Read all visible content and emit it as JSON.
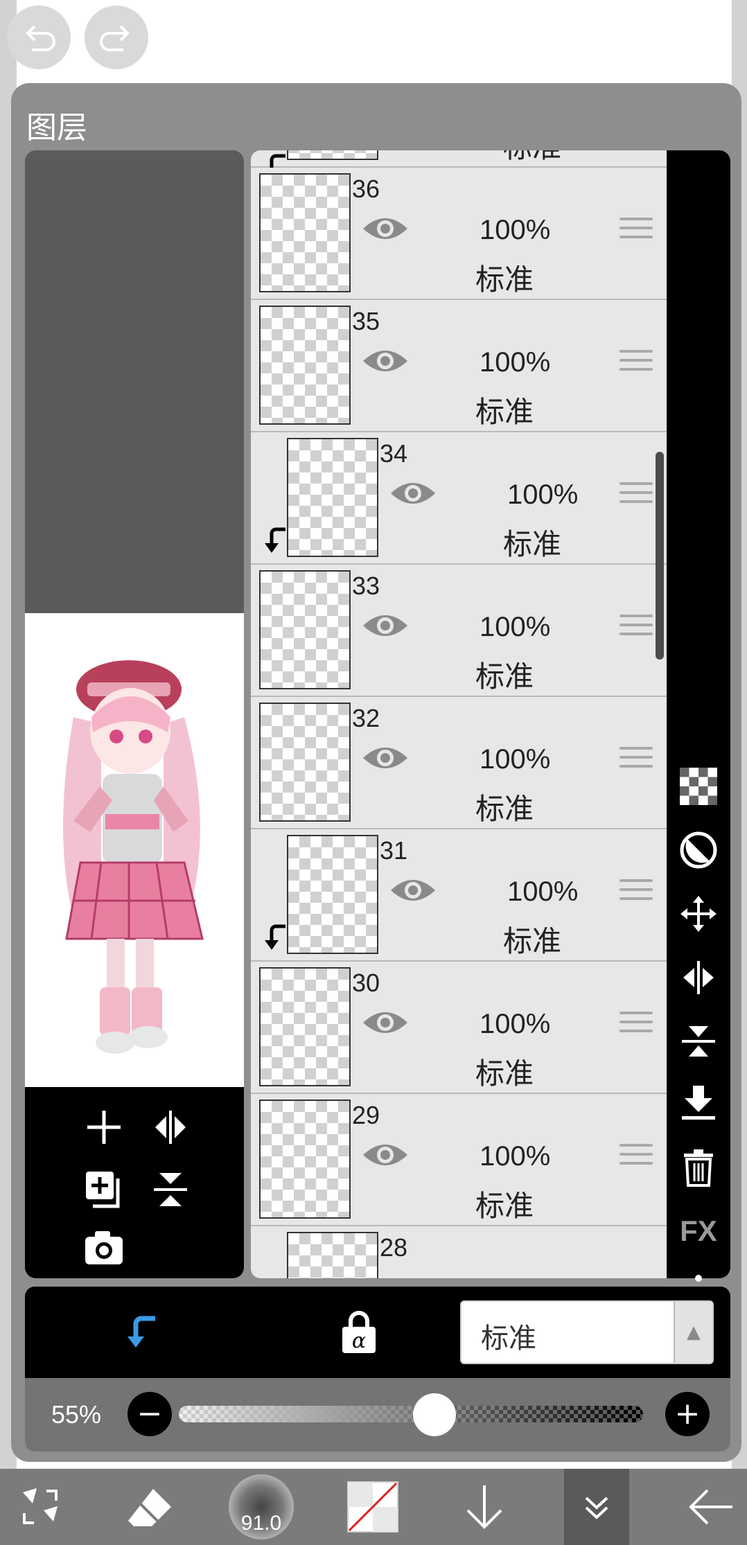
{
  "panel": {
    "title": "图层"
  },
  "layers": [
    {
      "number": "",
      "opacity": "",
      "blend": "标准",
      "clipped": true,
      "partial": "top"
    },
    {
      "number": "36",
      "opacity": "100%",
      "blend": "标准",
      "clipped": false
    },
    {
      "number": "35",
      "opacity": "100%",
      "blend": "标准",
      "clipped": false
    },
    {
      "number": "34",
      "opacity": "100%",
      "blend": "标准",
      "clipped": true
    },
    {
      "number": "33",
      "opacity": "100%",
      "blend": "标准",
      "clipped": false
    },
    {
      "number": "32",
      "opacity": "100%",
      "blend": "标准",
      "clipped": false
    },
    {
      "number": "31",
      "opacity": "100%",
      "blend": "标准",
      "clipped": true
    },
    {
      "number": "30",
      "opacity": "100%",
      "blend": "标准",
      "clipped": false
    },
    {
      "number": "29",
      "opacity": "100%",
      "blend": "标准",
      "clipped": false
    },
    {
      "number": "28",
      "opacity": "",
      "blend": "",
      "clipped": true,
      "partial": "bottom"
    }
  ],
  "right_tools": {
    "fx_label": "FX"
  },
  "blend_bar": {
    "blend_mode": "标准",
    "dropdown_arrow": "▲",
    "clip_icon": "clip-arrow-icon",
    "alpha_lock_icon": "alpha-lock-icon",
    "clip_color": "#3a9be8"
  },
  "opacity_bar": {
    "label": "55%",
    "value": 0.55,
    "minus": "−",
    "plus": "+"
  },
  "bottom_toolbar": {
    "brush_size": "91.0"
  },
  "colors": {
    "panel_bg": "#8e8e8e",
    "list_bg": "#e7e7e9",
    "toolbar_bg": "#000000"
  }
}
